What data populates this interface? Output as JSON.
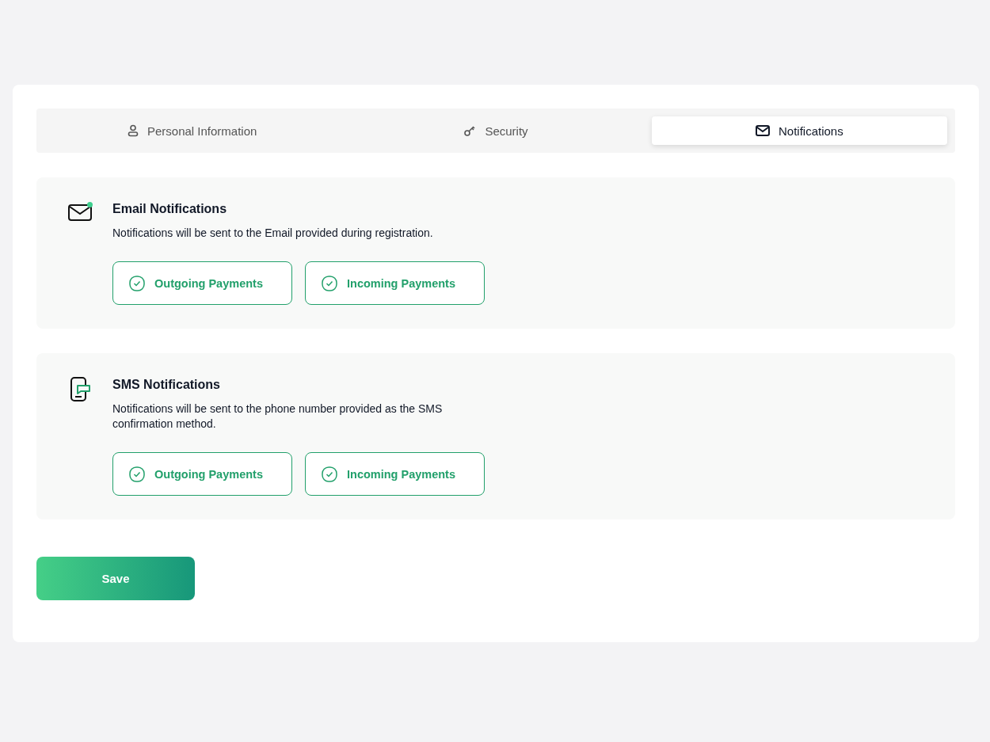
{
  "tabs": [
    {
      "label": "Personal Information",
      "kind": "person",
      "selected": false
    },
    {
      "label": "Security",
      "kind": "key",
      "selected": false
    },
    {
      "label": "Notifications",
      "kind": "mail",
      "selected": true
    }
  ],
  "sections": [
    {
      "kind": "email",
      "title": "Email Notifications",
      "description": "Notifications will be sent to the Email provided during registration.",
      "options": [
        {
          "label": "Outgoing Payments",
          "checked": true
        },
        {
          "label": "Incoming Payments",
          "checked": true
        }
      ]
    },
    {
      "kind": "sms",
      "title": "SMS Notifications",
      "description": "Notifications will be sent to the phone number provided as the SMS confirmation method.",
      "options": [
        {
          "label": "Outgoing Payments",
          "checked": true
        },
        {
          "label": "Incoming Payments",
          "checked": true
        }
      ]
    }
  ],
  "save_button": "Save"
}
